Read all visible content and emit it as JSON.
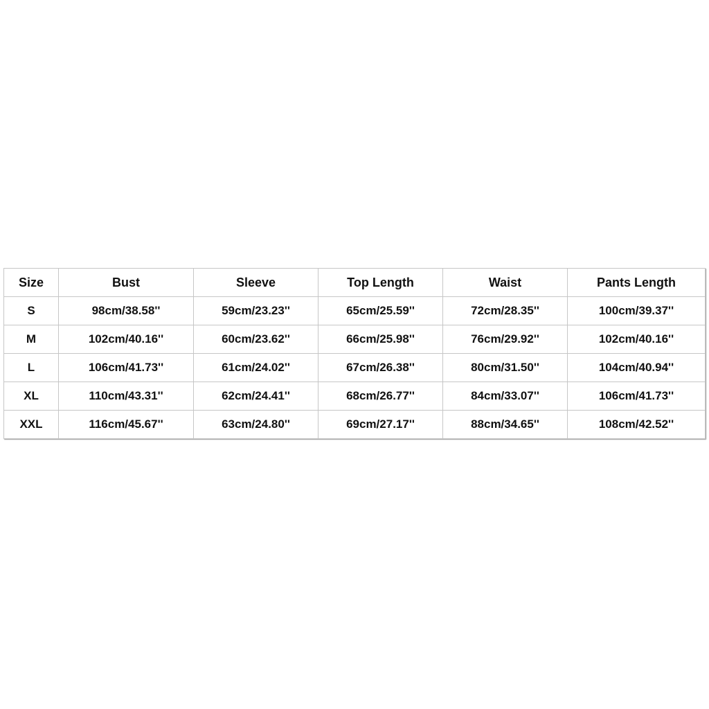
{
  "size_table": {
    "headers": [
      "Size",
      "Bust",
      "Sleeve",
      "Top Length",
      "Waist",
      "Pants Length"
    ],
    "rows": [
      [
        "S",
        "98cm/38.58''",
        "59cm/23.23''",
        "65cm/25.59''",
        "72cm/28.35''",
        "100cm/39.37''"
      ],
      [
        "M",
        "102cm/40.16''",
        "60cm/23.62''",
        "66cm/25.98''",
        "76cm/29.92''",
        "102cm/40.16''"
      ],
      [
        "L",
        "106cm/41.73''",
        "61cm/24.02''",
        "67cm/26.38''",
        "80cm/31.50''",
        "104cm/40.94''"
      ],
      [
        "XL",
        "110cm/43.31''",
        "62cm/24.41''",
        "68cm/26.77''",
        "84cm/33.07''",
        "106cm/41.73''"
      ],
      [
        "XXL",
        "116cm/45.67''",
        "63cm/24.80''",
        "69cm/27.17''",
        "88cm/34.65''",
        "108cm/42.52''"
      ]
    ]
  }
}
